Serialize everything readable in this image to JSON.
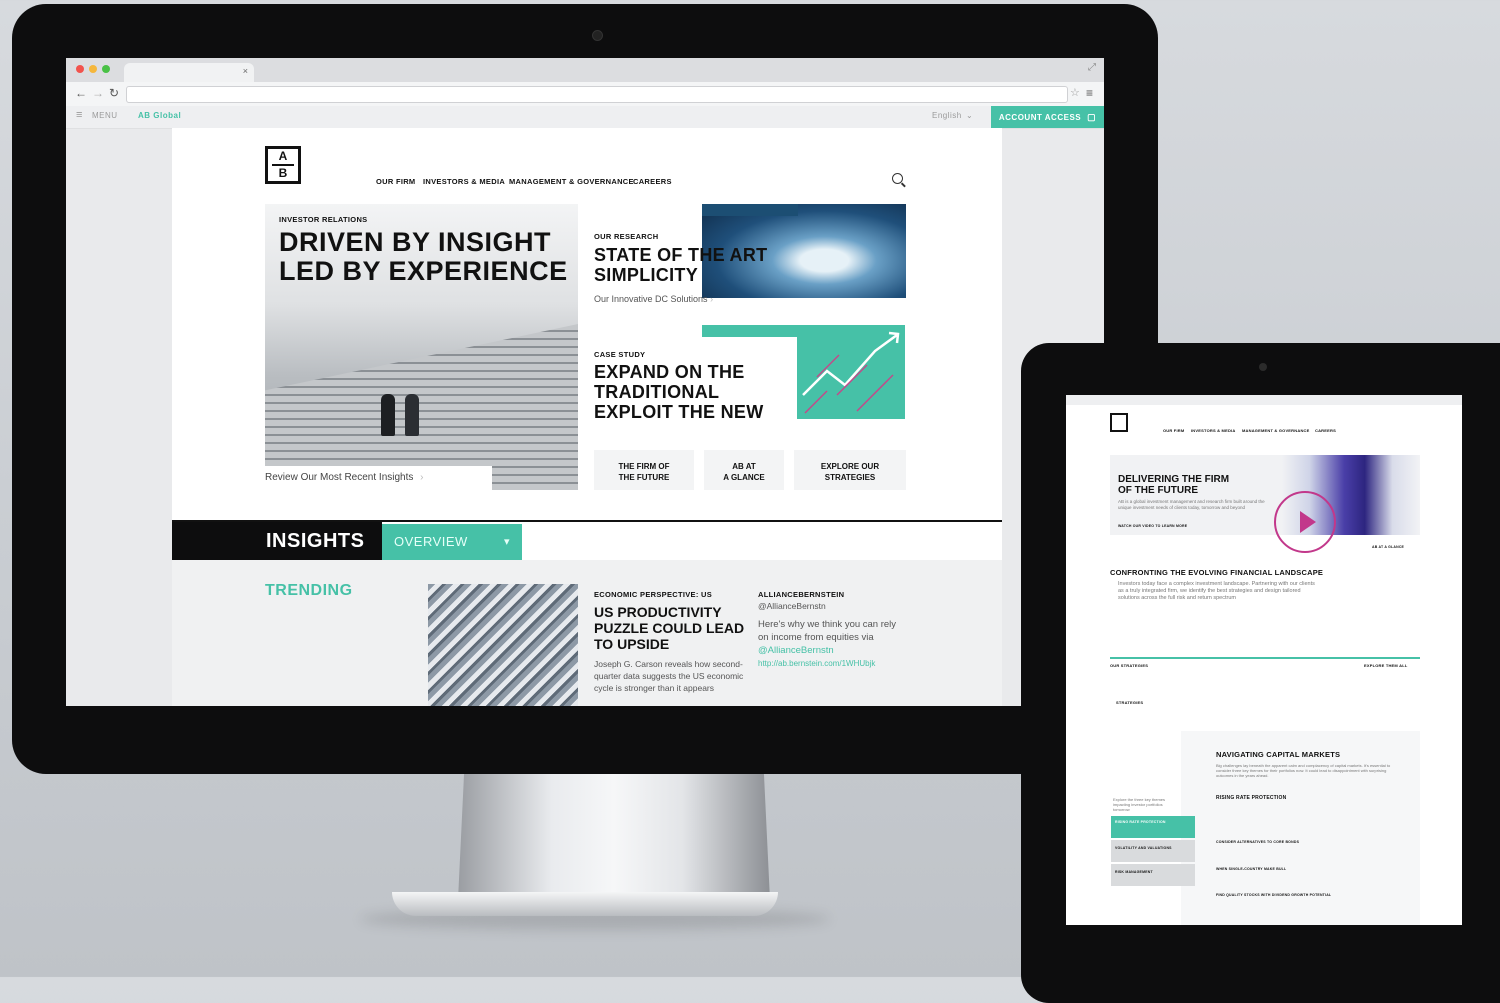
{
  "browser": {
    "menu_label": "MENU",
    "region_label": "AB Global",
    "language_label": "English",
    "account_access": "ACCOUNT ACCESS"
  },
  "site": {
    "logo_top": "A",
    "logo_bottom": "B",
    "nav": [
      "OUR FIRM",
      "INVESTORS & MEDIA",
      "MANAGEMENT & GOVERNANCE",
      "CAREERS"
    ],
    "hero": {
      "eyebrow": "INVESTOR RELATIONS",
      "title_line1": "DRIVEN BY INSIGHT",
      "title_line2": "LED BY EXPERIENCE",
      "cta": "Review Our Most Recent Insights"
    },
    "research": {
      "eyebrow": "OUR RESEARCH",
      "title_line1": "STATE OF THE ART",
      "title_line2": "SIMPLICITY",
      "link": "Our Innovative DC Solutions"
    },
    "case": {
      "eyebrow": "CASE STUDY",
      "title_line1": "EXPAND ON THE",
      "title_line2": "TRADITIONAL",
      "title_line3": "EXPLOIT THE NEW"
    },
    "tiles": [
      {
        "line1": "THE FIRM OF",
        "line2": "THE FUTURE"
      },
      {
        "line1": "AB AT",
        "line2": "A GLANCE"
      },
      {
        "line1": "EXPLORE OUR",
        "line2": "STRATEGIES"
      }
    ],
    "insights": {
      "title": "INSIGHTS",
      "dropdown": "OVERVIEW",
      "trending": "TRENDING"
    },
    "article": {
      "eyebrow": "ECONOMIC PERSPECTIVE: US",
      "title_line1": "US PRODUCTIVITY",
      "title_line2": "PUZZLE COULD LEAD",
      "title_line3": "TO UPSIDE",
      "body": "Joseph G. Carson reveals how second-quarter data suggests the US economic cycle is stronger than it appears"
    },
    "tweet": {
      "account": "ALLIANCEBERNSTEIN",
      "handle": "@AllianceBernstn",
      "text": "Here's why we think you can rely on income from equities via",
      "mention": "@AllianceBernstn",
      "link": "http://ab.bernstein.com/1WHUbjk"
    }
  },
  "tablet": {
    "nav": [
      "OUR FIRM",
      "INVESTORS & MEDIA",
      "MANAGEMENT & GOVERNANCE",
      "CAREERS"
    ],
    "hero_title_line1": "DELIVERING THE FIRM",
    "hero_title_line2": "OF THE FUTURE",
    "hero_body": "AB is a global investment management and research firm built around the unique investment needs of clients today, tomorrow and beyond",
    "hero_link": "WATCH OUR VIDEO TO LEARN MORE",
    "glance": "AB AT A GLANCE",
    "section_title": "CONFRONTING THE EVOLVING FINANCIAL LANDSCAPE",
    "section_body": "Investors today face a complex investment landscape. Partnering with our clients as a truly integrated firm, we identify the best strategies and design tailored solutions across the full risk and return spectrum",
    "strategies_label": "OUR STRATEGIES",
    "explore_all": "EXPLORE THEM ALL",
    "strategies_link": "STRATEGIES",
    "markets_title": "NAVIGATING CAPITAL MARKETS",
    "markets_body": "Big challenges lay beneath the apparent calm and complacency of capital markets. It's essential to consider three key themes for their portfolios now. It could lead to disappointment with surprising outcomes in the years ahead.",
    "side_intro": "Explore the three key themes impacting investor portfolios tomorrow",
    "side_items": [
      "RISING RATE PROTECTION",
      "VOLATILITY AND VALUATIONS",
      "RISK MANAGEMENT"
    ],
    "rising_rate": "RISING RATE PROTECTION",
    "consider": "CONSIDER ALTERNATIVES TO CORE BONDS",
    "quality": "FIND QUALITY STOCKS WITH DIVIDEND GROWTH POTENTIAL",
    "when_single": "WHEN SINGLE-COUNTRY MAKE BULL"
  },
  "colors": {
    "accent": "#46c1a7",
    "dark": "#0d0d0e"
  }
}
